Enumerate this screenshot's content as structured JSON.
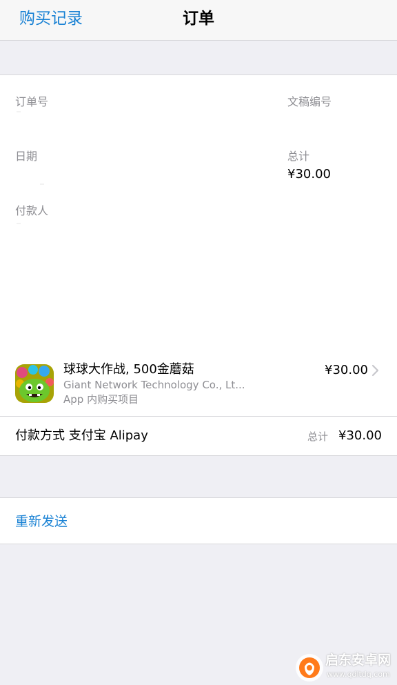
{
  "nav": {
    "back_label": "购买记录",
    "title": "订单"
  },
  "order": {
    "order_number_label": "订单号",
    "document_number_label": "文稿编号",
    "date_label": "日期",
    "total_label": "总计",
    "total_value": "¥30.00",
    "payer_label": "付款人"
  },
  "item": {
    "name": "球球大作战, 500金蘑菇",
    "developer": "Giant Network Technology Co., Lt...",
    "type": "App 内购买项目",
    "price": "¥30.00",
    "icon": "ball-battle-app-icon"
  },
  "payment": {
    "method_label": "付款方式 支付宝 Alipay",
    "total_label": "总计",
    "total_value": "¥30.00"
  },
  "actions": {
    "resend_label": "重新发送"
  },
  "watermark": {
    "name": "启东安卓网",
    "url": "www.qdltdq.com"
  },
  "colors": {
    "accent": "#1a82d4",
    "background": "#efeff4",
    "secondary_text": "#8e8e93"
  }
}
